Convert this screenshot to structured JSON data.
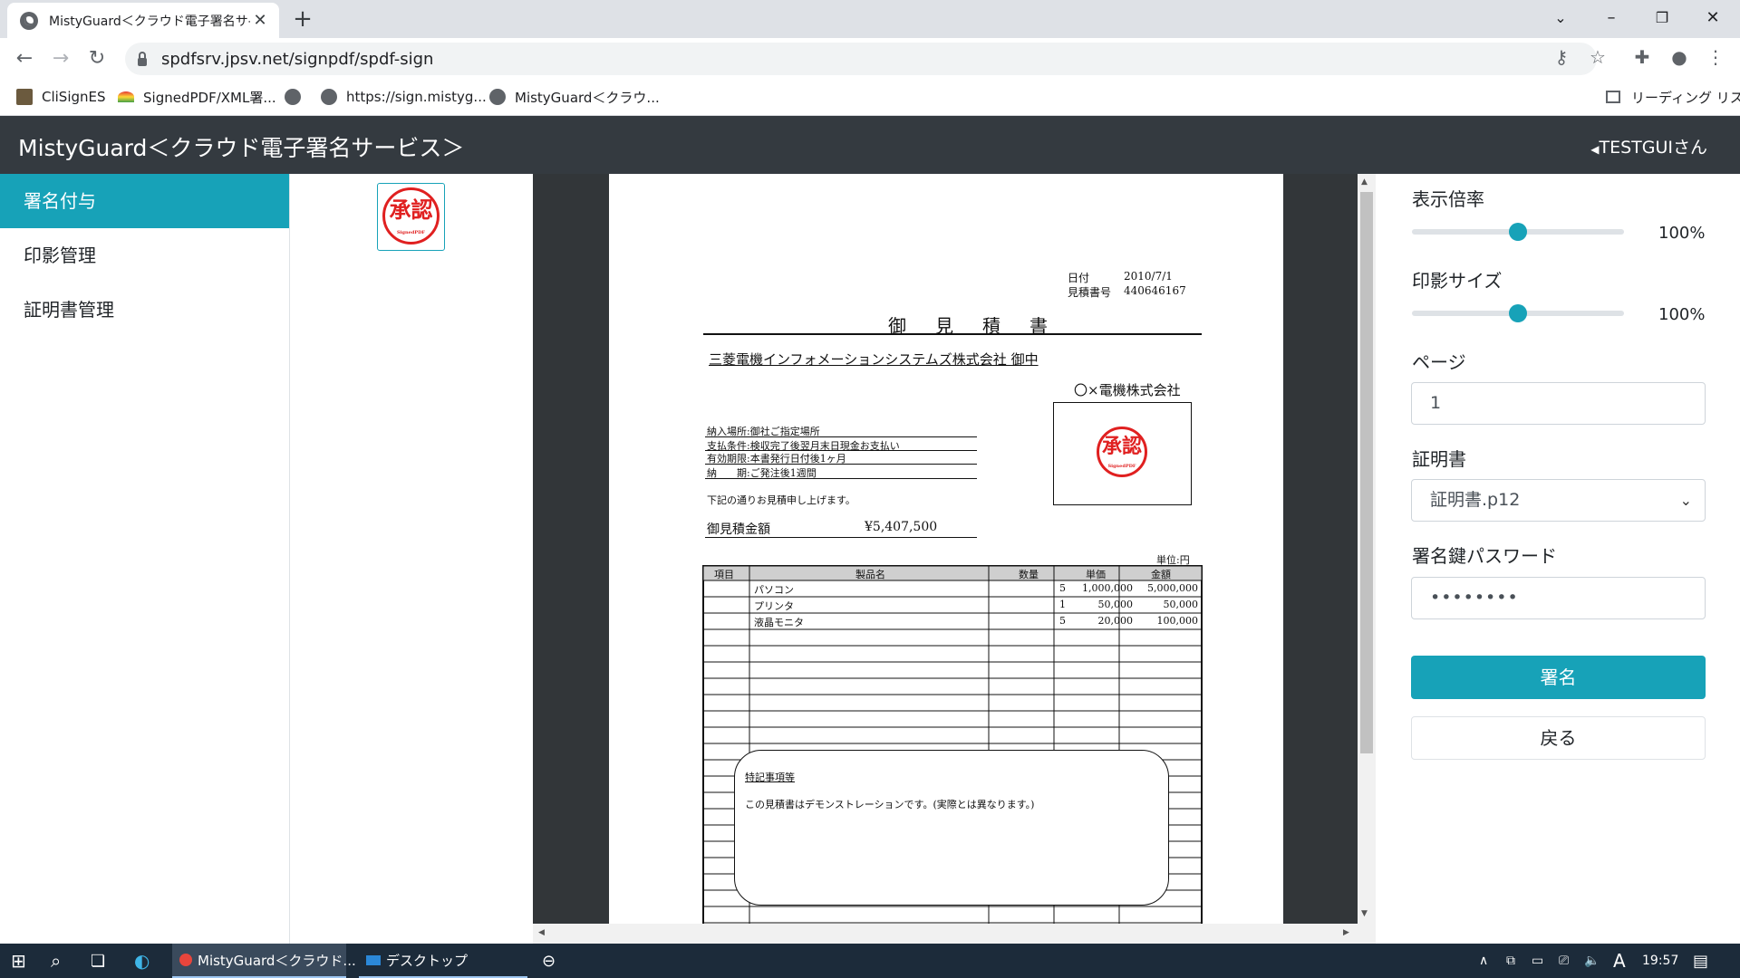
{
  "browser": {
    "tab_title": "MistyGuard＜クラウド電子署名サ-",
    "url": "spdfsrv.jpsv.net/signpdf/spdf-sign",
    "bookmarks": [
      "CliSignES",
      "SignedPDF/XML署...",
      "",
      "https://sign.mistyg...",
      "MistyGuard＜クラウ..."
    ],
    "reading_list": "リーディング リスト"
  },
  "app": {
    "title": "MistyGuard＜クラウド電子署名サービス＞",
    "user": "TESTGUIさん"
  },
  "sidebar": {
    "items": [
      {
        "label": "署名付与",
        "active": true
      },
      {
        "label": "印影管理",
        "active": false
      },
      {
        "label": "証明書管理",
        "active": false
      }
    ]
  },
  "stamp": {
    "text": "承認",
    "sub": "SignedPDF"
  },
  "controls": {
    "zoom_label": "表示倍率",
    "zoom_value": "100%",
    "zoom_level": 0.5,
    "stamp_size_label": "印影サイズ",
    "stamp_size_value": "100%",
    "stamp_size_level": 0.5,
    "page_label": "ページ",
    "page_value": "1",
    "cert_label": "証明書",
    "cert_value": "証明書.p12",
    "password_label": "署名鍵パスワード",
    "password_value": "••••••••",
    "sign_button": "署名",
    "back_button": "戻る"
  },
  "document": {
    "date_label": "日付",
    "date_value": "2010/7/1",
    "number_label": "見積書号",
    "number_value": "440646167",
    "title": "御　見　積　書",
    "recipient": "三菱電機インフォメーションシステムズ株式会社 御中",
    "issuer": "〇×電機株式会社",
    "terms": [
      "納入場所:御社ご指定場所",
      "支払条件:検収完了後翌月末日現金お支払い",
      "有効期限:本書発行日付後1ヶ月",
      "納　　期:ご発注後1週間"
    ],
    "intro": "下記の通りお見積申し上げます。",
    "total_label": "御見積金額",
    "total_value": "¥5,407,500",
    "unit_note": "単位:円",
    "table_headers": [
      "項目",
      "製品名",
      "数量",
      "単価",
      "金額"
    ],
    "table_rows": [
      [
        "",
        "パソコン",
        "5",
        "1,000,000",
        "5,000,000"
      ],
      [
        "",
        "プリンタ",
        "1",
        "50,000",
        "50,000"
      ],
      [
        "",
        "液晶モニタ",
        "5",
        "20,000",
        "100,000"
      ]
    ],
    "notes_title": "特記事項等",
    "notes_text": "この見積書はデモンストレーションです。(実際とは異なります。)"
  },
  "taskbar": {
    "chrome_task": "MistyGuard＜クラウド...",
    "desktop_task": "デスクトップ",
    "ime": "A",
    "time": "19:57"
  },
  "colors": {
    "accent": "#17a2b8",
    "header": "#343a40",
    "stamp_red": "#e02020"
  }
}
